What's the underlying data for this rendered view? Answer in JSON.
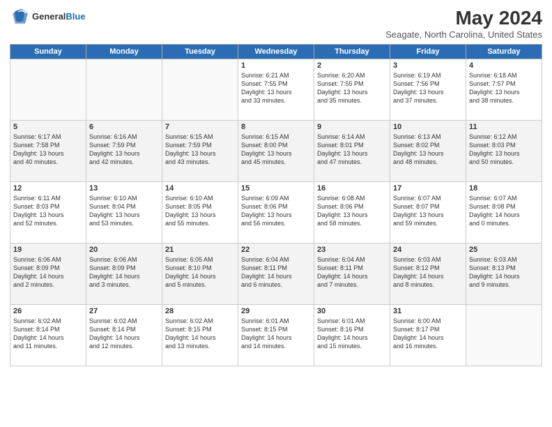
{
  "logo": {
    "general": "General",
    "blue": "Blue"
  },
  "header": {
    "month": "May 2024",
    "location": "Seagate, North Carolina, United States"
  },
  "weekdays": [
    "Sunday",
    "Monday",
    "Tuesday",
    "Wednesday",
    "Thursday",
    "Friday",
    "Saturday"
  ],
  "weeks": [
    [
      {
        "day": "",
        "content": ""
      },
      {
        "day": "",
        "content": ""
      },
      {
        "day": "",
        "content": ""
      },
      {
        "day": "1",
        "content": "Sunrise: 6:21 AM\nSunset: 7:55 PM\nDaylight: 13 hours\nand 33 minutes."
      },
      {
        "day": "2",
        "content": "Sunrise: 6:20 AM\nSunset: 7:55 PM\nDaylight: 13 hours\nand 35 minutes."
      },
      {
        "day": "3",
        "content": "Sunrise: 6:19 AM\nSunset: 7:56 PM\nDaylight: 13 hours\nand 37 minutes."
      },
      {
        "day": "4",
        "content": "Sunrise: 6:18 AM\nSunset: 7:57 PM\nDaylight: 13 hours\nand 38 minutes."
      }
    ],
    [
      {
        "day": "5",
        "content": "Sunrise: 6:17 AM\nSunset: 7:58 PM\nDaylight: 13 hours\nand 40 minutes."
      },
      {
        "day": "6",
        "content": "Sunrise: 6:16 AM\nSunset: 7:59 PM\nDaylight: 13 hours\nand 42 minutes."
      },
      {
        "day": "7",
        "content": "Sunrise: 6:15 AM\nSunset: 7:59 PM\nDaylight: 13 hours\nand 43 minutes."
      },
      {
        "day": "8",
        "content": "Sunrise: 6:15 AM\nSunset: 8:00 PM\nDaylight: 13 hours\nand 45 minutes."
      },
      {
        "day": "9",
        "content": "Sunrise: 6:14 AM\nSunset: 8:01 PM\nDaylight: 13 hours\nand 47 minutes."
      },
      {
        "day": "10",
        "content": "Sunrise: 6:13 AM\nSunset: 8:02 PM\nDaylight: 13 hours\nand 48 minutes."
      },
      {
        "day": "11",
        "content": "Sunrise: 6:12 AM\nSunset: 8:03 PM\nDaylight: 13 hours\nand 50 minutes."
      }
    ],
    [
      {
        "day": "12",
        "content": "Sunrise: 6:11 AM\nSunset: 8:03 PM\nDaylight: 13 hours\nand 52 minutes."
      },
      {
        "day": "13",
        "content": "Sunrise: 6:10 AM\nSunset: 8:04 PM\nDaylight: 13 hours\nand 53 minutes."
      },
      {
        "day": "14",
        "content": "Sunrise: 6:10 AM\nSunset: 8:05 PM\nDaylight: 13 hours\nand 55 minutes."
      },
      {
        "day": "15",
        "content": "Sunrise: 6:09 AM\nSunset: 8:06 PM\nDaylight: 13 hours\nand 56 minutes."
      },
      {
        "day": "16",
        "content": "Sunrise: 6:08 AM\nSunset: 8:06 PM\nDaylight: 13 hours\nand 58 minutes."
      },
      {
        "day": "17",
        "content": "Sunrise: 6:07 AM\nSunset: 8:07 PM\nDaylight: 13 hours\nand 59 minutes."
      },
      {
        "day": "18",
        "content": "Sunrise: 6:07 AM\nSunset: 8:08 PM\nDaylight: 14 hours\nand 0 minutes."
      }
    ],
    [
      {
        "day": "19",
        "content": "Sunrise: 6:06 AM\nSunset: 8:09 PM\nDaylight: 14 hours\nand 2 minutes."
      },
      {
        "day": "20",
        "content": "Sunrise: 6:06 AM\nSunset: 8:09 PM\nDaylight: 14 hours\nand 3 minutes."
      },
      {
        "day": "21",
        "content": "Sunrise: 6:05 AM\nSunset: 8:10 PM\nDaylight: 14 hours\nand 5 minutes."
      },
      {
        "day": "22",
        "content": "Sunrise: 6:04 AM\nSunset: 8:11 PM\nDaylight: 14 hours\nand 6 minutes."
      },
      {
        "day": "23",
        "content": "Sunrise: 6:04 AM\nSunset: 8:11 PM\nDaylight: 14 hours\nand 7 minutes."
      },
      {
        "day": "24",
        "content": "Sunrise: 6:03 AM\nSunset: 8:12 PM\nDaylight: 14 hours\nand 8 minutes."
      },
      {
        "day": "25",
        "content": "Sunrise: 6:03 AM\nSunset: 8:13 PM\nDaylight: 14 hours\nand 9 minutes."
      }
    ],
    [
      {
        "day": "26",
        "content": "Sunrise: 6:02 AM\nSunset: 8:14 PM\nDaylight: 14 hours\nand 11 minutes."
      },
      {
        "day": "27",
        "content": "Sunrise: 6:02 AM\nSunset: 8:14 PM\nDaylight: 14 hours\nand 12 minutes."
      },
      {
        "day": "28",
        "content": "Sunrise: 6:02 AM\nSunset: 8:15 PM\nDaylight: 14 hours\nand 13 minutes."
      },
      {
        "day": "29",
        "content": "Sunrise: 6:01 AM\nSunset: 8:15 PM\nDaylight: 14 hours\nand 14 minutes."
      },
      {
        "day": "30",
        "content": "Sunrise: 6:01 AM\nSunset: 8:16 PM\nDaylight: 14 hours\nand 15 minutes."
      },
      {
        "day": "31",
        "content": "Sunrise: 6:00 AM\nSunset: 8:17 PM\nDaylight: 14 hours\nand 16 minutes."
      },
      {
        "day": "",
        "content": ""
      }
    ]
  ]
}
